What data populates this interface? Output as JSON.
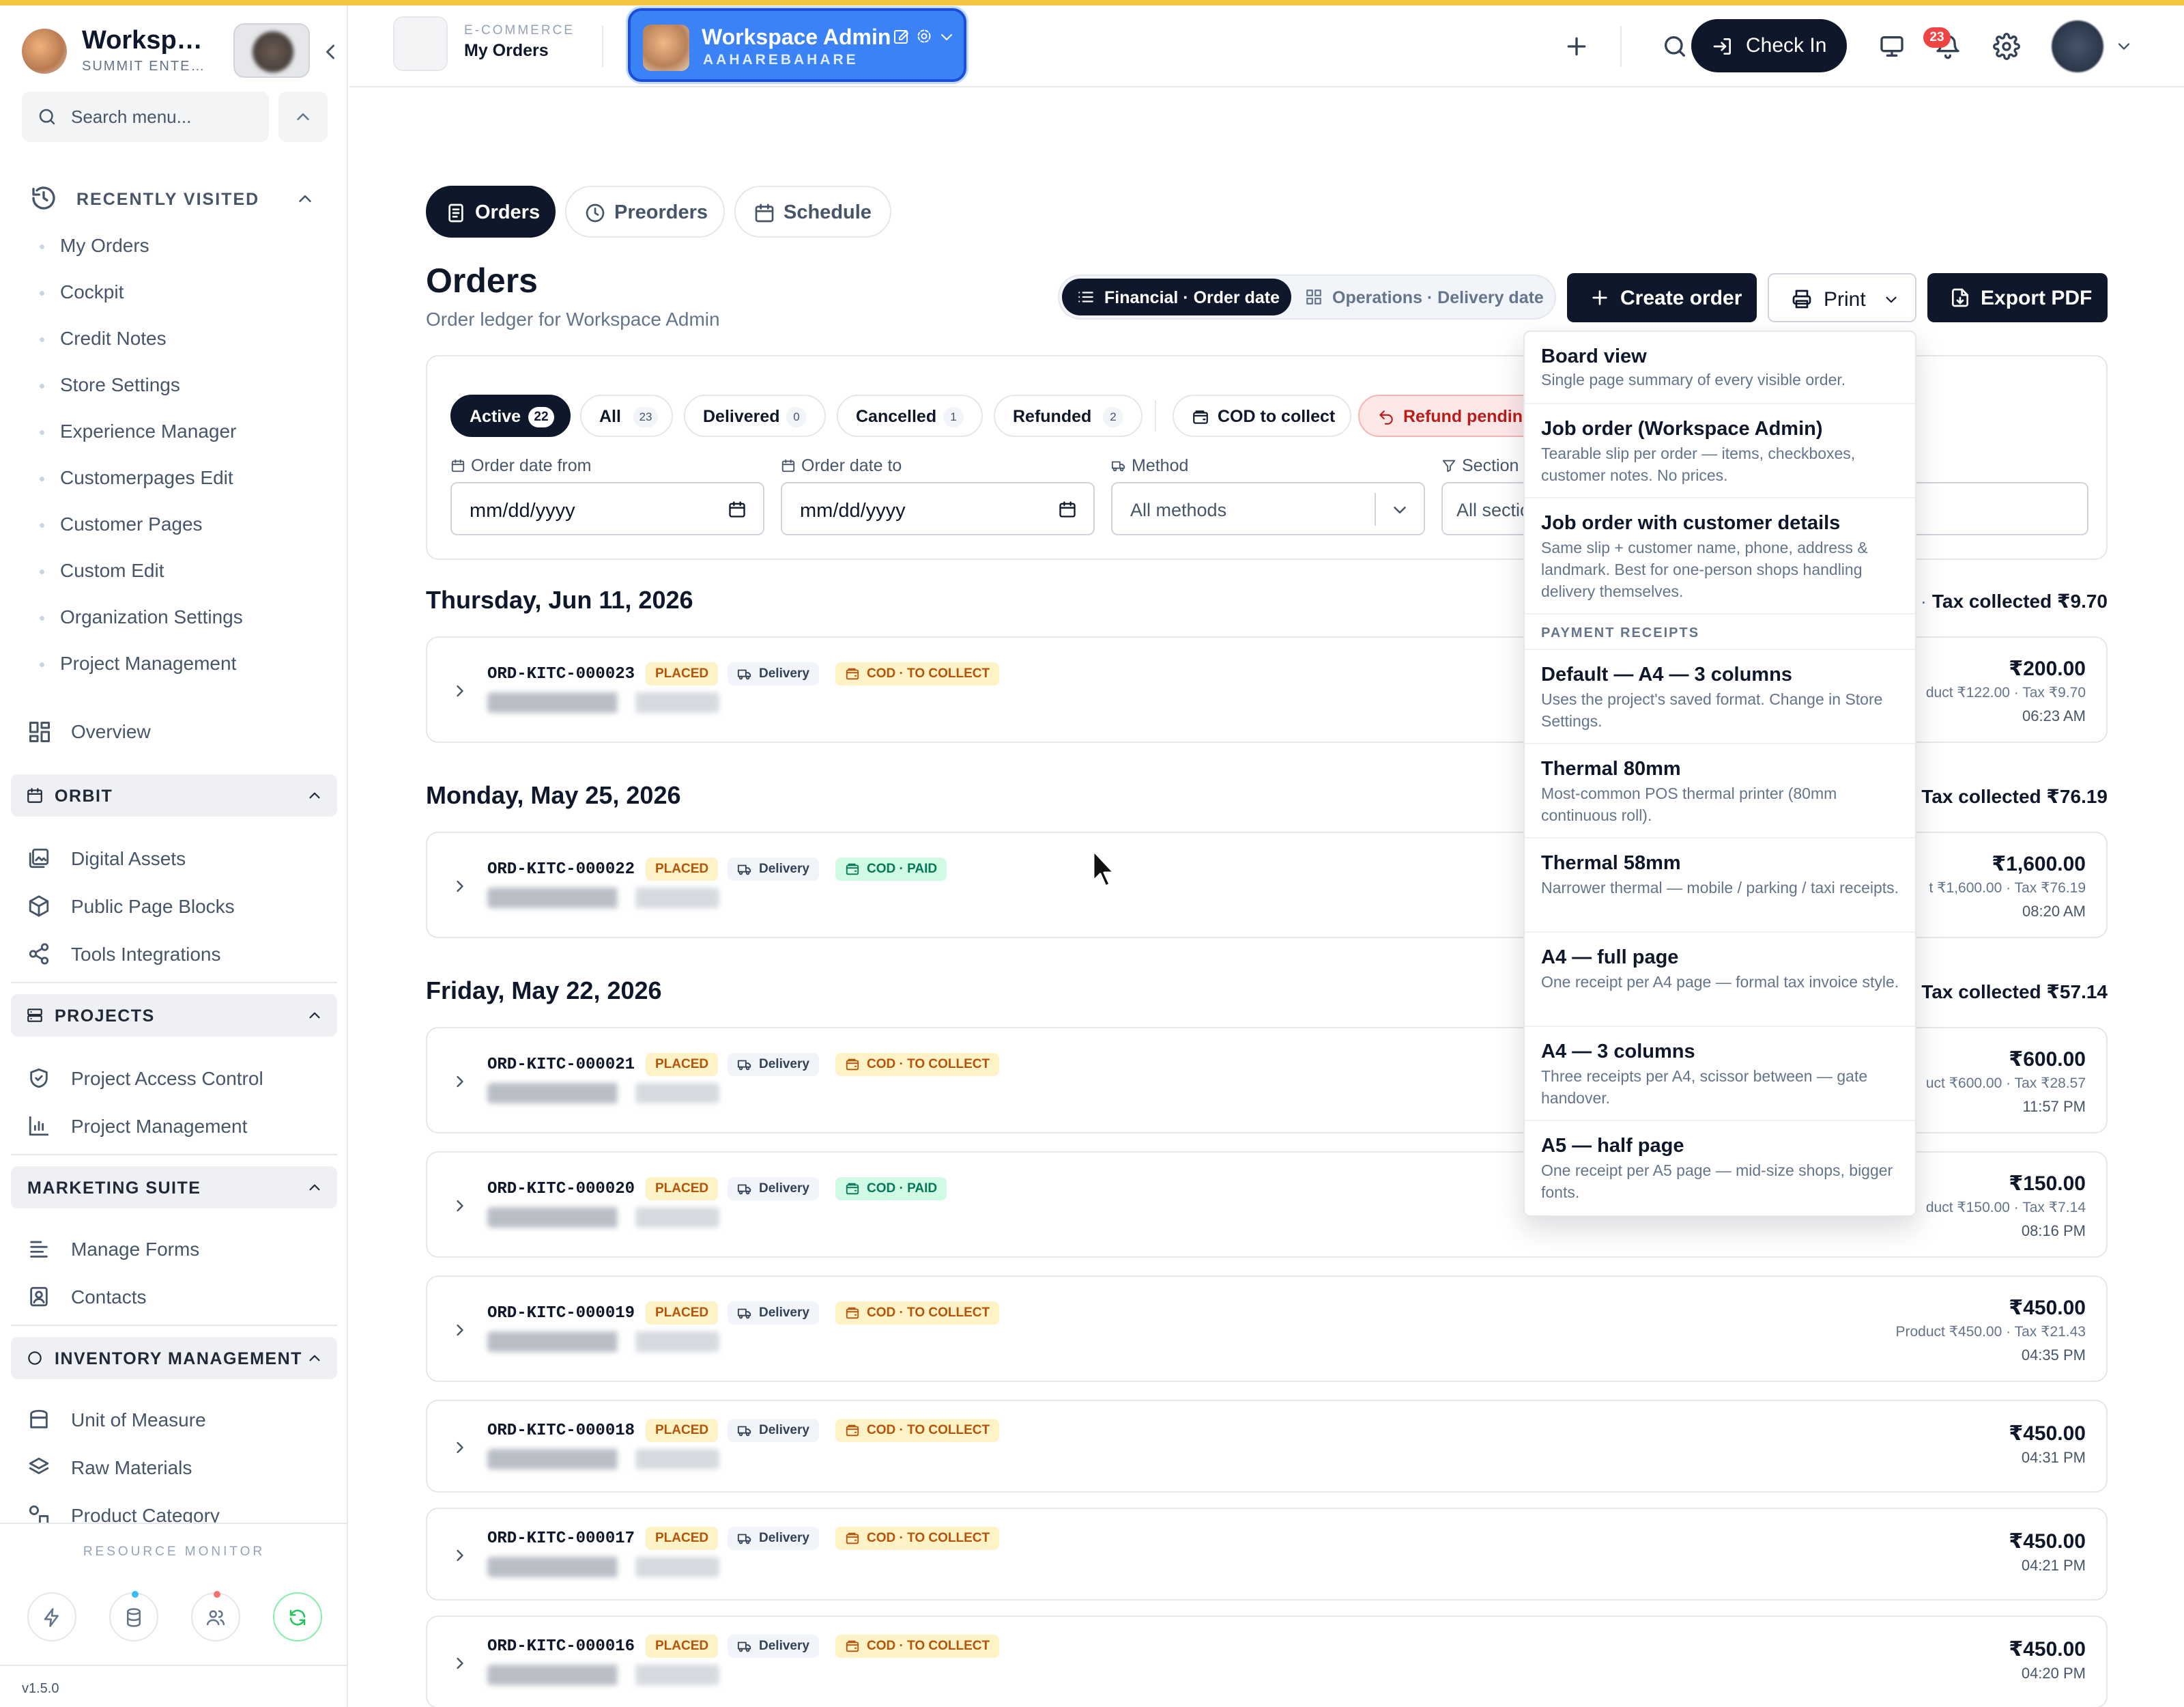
{
  "sidebar": {
    "brand": "Worksp…",
    "brand_sub": "SUMMIT ENTE…",
    "search_placeholder": "Search menu...",
    "recent_title": "RECENTLY VISITED",
    "recent": [
      "My Orders",
      "Cockpit",
      "Credit Notes",
      "Store Settings",
      "Experience Manager",
      "Customerpages Edit",
      "Customer Pages",
      "Custom Edit",
      "Organization Settings",
      "Project Management"
    ],
    "overview": "Overview",
    "orbit": {
      "title": "ORBIT",
      "items": [
        "Digital Assets",
        "Public Page Blocks",
        "Tools Integrations"
      ]
    },
    "projects": {
      "title": "PROJECTS",
      "items": [
        "Project Access Control",
        "Project Management"
      ]
    },
    "marketing": {
      "title": "MARKETING SUITE",
      "items": [
        "Manage Forms",
        "Contacts"
      ]
    },
    "inventory": {
      "title": "INVENTORY MANAGEMENT",
      "items": [
        "Unit of Measure",
        "Raw Materials",
        "Product Category"
      ]
    },
    "resource_title": "RESOURCE MONITOR",
    "version": "v1.5.0"
  },
  "topbar": {
    "crumb_top": "E-COMMERCE",
    "crumb_main": "My Orders",
    "workspace_name": "Workspace Admin",
    "workspace_sub": "AAHAREBAHARE",
    "checkin_label": "Check In",
    "notif_count": "23"
  },
  "tabs": [
    "Orders",
    "Preorders",
    "Schedule"
  ],
  "page": {
    "title": "Orders",
    "subtitle": "Order ledger for Workspace Admin",
    "seg_a": "Financial · Order date",
    "seg_b": "Operations · Delivery date",
    "create_label": "Create order",
    "print_label": "Print",
    "export_label": "Export PDF"
  },
  "filters": {
    "chips": [
      {
        "label": "Active",
        "count": "22"
      },
      {
        "label": "All",
        "count": "23"
      },
      {
        "label": "Delivered",
        "count": "0"
      },
      {
        "label": "Cancelled",
        "count": "1"
      },
      {
        "label": "Refunded",
        "count": "2"
      }
    ],
    "cod_label": "COD to collect",
    "refund_label": "Refund pending",
    "date_from_label": "Order date from",
    "date_from_value": "mm/dd/yyyy",
    "date_to_label": "Order date to",
    "date_to_value": "mm/dd/yyyy",
    "method_label": "Method",
    "method_value": "All methods",
    "section_label": "Section",
    "section_value": "All sectio",
    "phone_value": "hone"
  },
  "days": [
    {
      "date": "Thursday, Jun 11, 2026",
      "tax_prefix": "·",
      "tax": "Tax collected ₹9.70"
    },
    {
      "date": "Monday, May 25, 2026",
      "tax": "Tax collected ₹76.19"
    },
    {
      "date": "Friday, May 22, 2026",
      "tax": "Tax collected ₹57.14"
    }
  ],
  "orders": [
    {
      "id": "ORD-KITC-000023",
      "status": "PLACED",
      "method": "Delivery",
      "cod": "COD · TO COLLECT",
      "amount": "₹200.00",
      "meta": "duct ₹122.00 · Tax ₹9.70",
      "time": "06:23 AM"
    },
    {
      "id": "ORD-KITC-000022",
      "status": "PLACED",
      "method": "Delivery",
      "cod": "COD · PAID",
      "amount": "₹1,600.00",
      "meta": "t ₹1,600.00 · Tax ₹76.19",
      "time": "08:20 AM"
    },
    {
      "id": "ORD-KITC-000021",
      "status": "PLACED",
      "method": "Delivery",
      "cod": "COD · TO COLLECT",
      "amount": "₹600.00",
      "meta": "uct ₹600.00 · Tax ₹28.57",
      "time": "11:57 PM"
    },
    {
      "id": "ORD-KITC-000020",
      "status": "PLACED",
      "method": "Delivery",
      "cod": "COD · PAID",
      "amount": "₹150.00",
      "meta": "duct ₹150.00 · Tax ₹7.14",
      "time": "08:16 PM"
    },
    {
      "id": "ORD-KITC-000019",
      "status": "PLACED",
      "method": "Delivery",
      "cod": "COD · TO COLLECT",
      "amount": "₹450.00",
      "meta": "Product ₹450.00 · Tax ₹21.43",
      "time": "04:35 PM"
    },
    {
      "id": "ORD-KITC-000018",
      "status": "PLACED",
      "method": "Delivery",
      "cod": "COD · TO COLLECT",
      "amount": "₹450.00",
      "meta": "",
      "time": "04:31 PM"
    },
    {
      "id": "ORD-KITC-000017",
      "status": "PLACED",
      "method": "Delivery",
      "cod": "COD · TO COLLECT",
      "amount": "₹450.00",
      "meta": "",
      "time": "04:21 PM"
    },
    {
      "id": "ORD-KITC-000016",
      "status": "PLACED",
      "method": "Delivery",
      "cod": "COD · TO COLLECT",
      "amount": "₹450.00",
      "meta": "",
      "time": "04:20 PM"
    }
  ],
  "print_menu": {
    "items": [
      {
        "title": "Board view",
        "desc": "Single page summary of every visible order."
      },
      {
        "title": "Job order (Workspace Admin)",
        "desc": "Tearable slip per order — items, checkboxes, customer notes. No prices."
      },
      {
        "title": "Job order with customer details",
        "desc": "Same slip + customer name, phone, address & landmark. Best for one-person shops handling delivery themselves."
      }
    ],
    "section": "PAYMENT RECEIPTS",
    "receipts": [
      {
        "title": "Default — A4 — 3 columns",
        "desc": "Uses the project's saved format. Change in Store Settings."
      },
      {
        "title": "Thermal 80mm",
        "desc": "Most-common POS thermal printer (80mm continuous roll)."
      },
      {
        "title": "Thermal 58mm",
        "desc": "Narrower thermal — mobile / parking / taxi receipts."
      },
      {
        "title": "A4 — full page",
        "desc": "One receipt per A4 page — formal tax invoice style."
      },
      {
        "title": "A4 — 3 columns",
        "desc": "Three receipts per A4, scissor between — gate handover."
      },
      {
        "title": "A5 — half page",
        "desc": "One receipt per A5 page — mid-size shops, bigger fonts."
      }
    ]
  },
  "colors": {
    "accent": "#f5c542",
    "workspace_pill": "#3b82f6",
    "dark": "#0f172a",
    "badge_red": "#ef4444"
  }
}
